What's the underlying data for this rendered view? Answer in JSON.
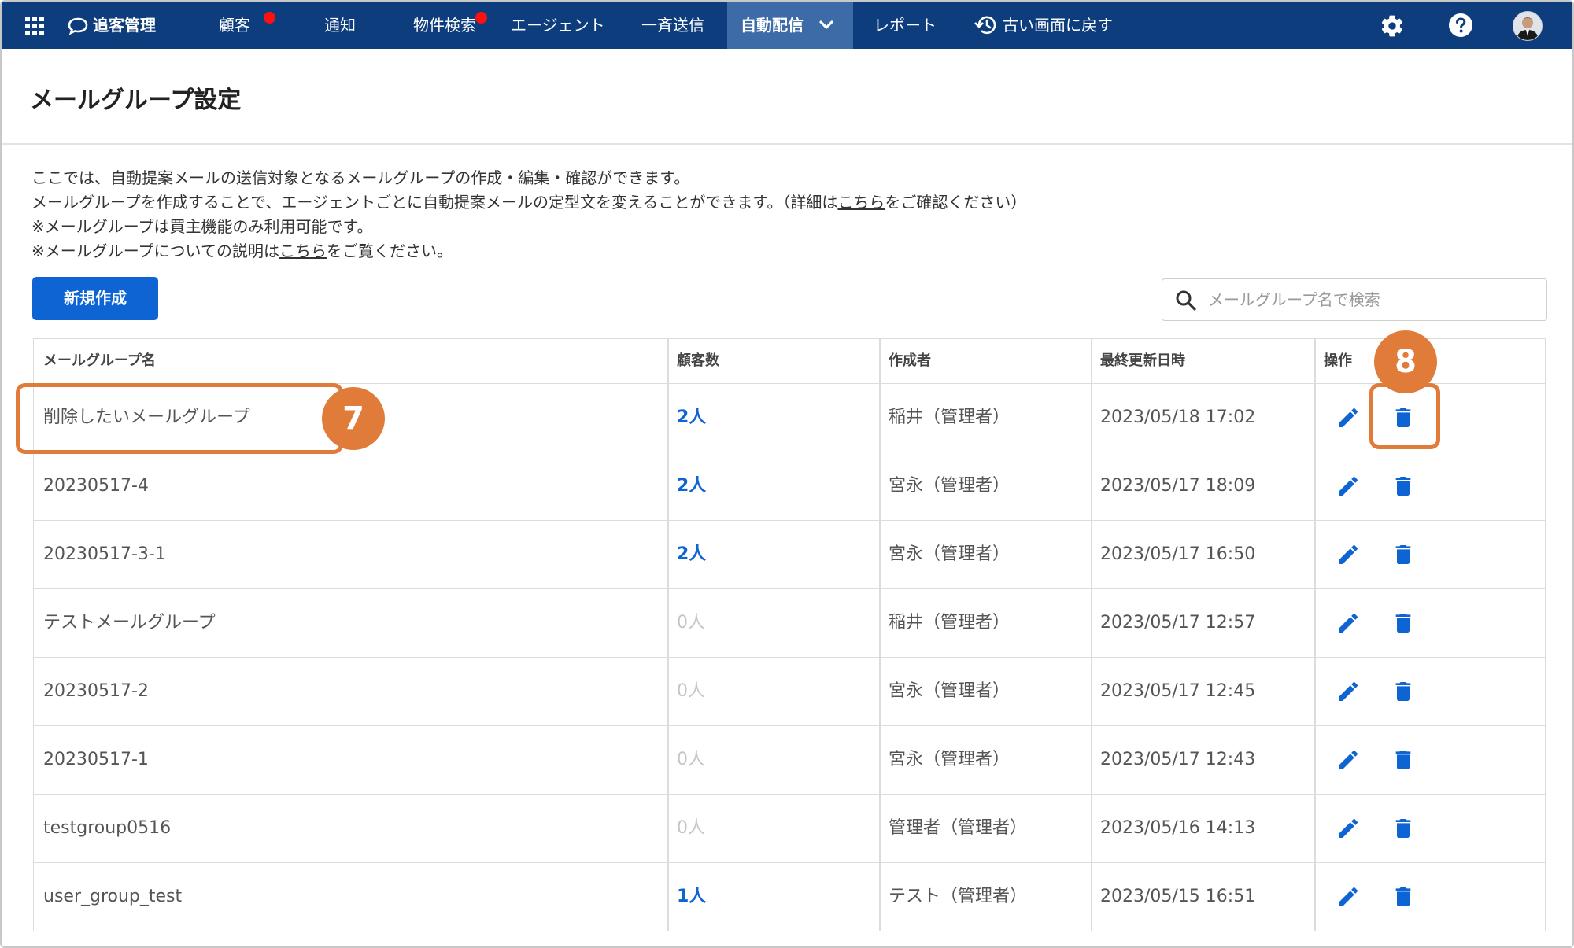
{
  "nav": {
    "logo": "追客管理",
    "items": [
      {
        "label": "顧客",
        "badge": true
      },
      {
        "label": "通知",
        "badge": false
      },
      {
        "label": "物件検索",
        "badge": true
      },
      {
        "label": "エージェント",
        "badge": false
      },
      {
        "label": "一斉送信",
        "badge": false
      },
      {
        "label": "自動配信",
        "badge": false,
        "active": true
      },
      {
        "label": "レポート",
        "badge": false
      },
      {
        "label": "古い画面に戻す",
        "badge": false
      }
    ],
    "accent": "#0d3d7c",
    "active_bg": "#3d6ba8",
    "badge_color": "#ff1010"
  },
  "page": {
    "title": "メールグループ設定",
    "desc": [
      "ここでは、自動提案メールの送信対象となるメールグループの作成・編集・確認ができます。",
      "メールグループを作成することで、エージェントごとに自動提案メールの定型文を変えることができます。（詳細は",
      "こちら",
      "をご確認ください）",
      "※メールグループは買主機能のみ利用可能です。",
      "※メールグループについての説明は",
      "こちら",
      "をご覧ください。"
    ],
    "new_button": "新規作成",
    "search_placeholder": "メールグループ名で検索",
    "primary_color": "#0d64d2"
  },
  "table": {
    "headers": [
      "メールグループ名",
      "顧客数",
      "作成者",
      "最終更新日時",
      "操作"
    ],
    "rows": [
      {
        "name": "削除したいメールグループ",
        "count": "2人",
        "active": true,
        "creator": "稲井（管理者）",
        "updated": "2023/05/18 17:02"
      },
      {
        "name": "20230517-4",
        "count": "2人",
        "active": true,
        "creator": "宮永（管理者）",
        "updated": "2023/05/17 18:09"
      },
      {
        "name": "20230517-3-1",
        "count": "2人",
        "active": true,
        "creator": "宮永（管理者）",
        "updated": "2023/05/17 16:50"
      },
      {
        "name": "テストメールグループ",
        "count": "0人",
        "active": false,
        "creator": "稲井（管理者）",
        "updated": "2023/05/17 12:57"
      },
      {
        "name": "20230517-2",
        "count": "0人",
        "active": false,
        "creator": "宮永（管理者）",
        "updated": "2023/05/17 12:45"
      },
      {
        "name": "20230517-1",
        "count": "0人",
        "active": false,
        "creator": "宮永（管理者）",
        "updated": "2023/05/17 12:43"
      },
      {
        "name": "testgroup0516",
        "count": "0人",
        "active": false,
        "creator": "管理者（管理者）",
        "updated": "2023/05/16 14:13"
      },
      {
        "name": "user_group_test",
        "count": "1人",
        "active": true,
        "creator": "テスト（管理者）",
        "updated": "2023/05/15 16:51"
      }
    ]
  },
  "callouts": {
    "name_step": "7",
    "delete_step": "8",
    "color": "#e07b3a"
  }
}
